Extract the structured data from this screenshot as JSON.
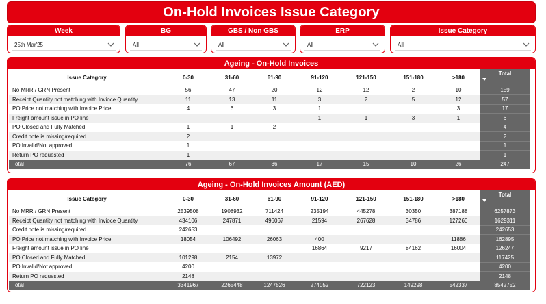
{
  "page_title": "On-Hold Invoices Issue Category",
  "filters": [
    {
      "label": "Week",
      "value": "25th Mar'25"
    },
    {
      "label": "BG",
      "value": "All"
    },
    {
      "label": "GBS / Non GBS",
      "value": "All"
    },
    {
      "label": "ERP",
      "value": "All"
    },
    {
      "label": "Issue Category",
      "value": "All"
    }
  ],
  "table1": {
    "title": "Ageing - On-Hold Invoices",
    "columns": [
      "Issue Category",
      "0-30",
      "31-60",
      "61-90",
      "91-120",
      "121-150",
      "151-180",
      ">180",
      "Total"
    ],
    "rows": [
      [
        "No MRR / GRN Present",
        "56",
        "47",
        "20",
        "12",
        "12",
        "2",
        "10",
        "159"
      ],
      [
        "Receipt Quantity not matching with Invioce Quantity",
        "11",
        "13",
        "11",
        "3",
        "2",
        "5",
        "12",
        "57"
      ],
      [
        "PO Price not matching with Invoice Price",
        "4",
        "6",
        "3",
        "1",
        "",
        "",
        "3",
        "17"
      ],
      [
        "Freight amount issue in PO line",
        "",
        "",
        "",
        "1",
        "1",
        "3",
        "1",
        "6"
      ],
      [
        "PO Closed and Fully Matched",
        "1",
        "1",
        "2",
        "",
        "",
        "",
        "",
        "4"
      ],
      [
        "Credit note is missing/required",
        "2",
        "",
        "",
        "",
        "",
        "",
        "",
        "2"
      ],
      [
        "PO Invalid/Not approved",
        "1",
        "",
        "",
        "",
        "",
        "",
        "",
        "1"
      ],
      [
        "Return PO requested",
        "1",
        "",
        "",
        "",
        "",
        "",
        "",
        "1"
      ]
    ],
    "total_row": [
      "Total",
      "76",
      "67",
      "36",
      "17",
      "15",
      "10",
      "26",
      "247"
    ]
  },
  "table2": {
    "title": "Ageing - On-Hold Invoices Amount (AED)",
    "columns": [
      "Issue Category",
      "0-30",
      "31-60",
      "61-90",
      "91-120",
      "121-150",
      "151-180",
      ">180",
      "Total"
    ],
    "rows": [
      [
        "No MRR / GRN Present",
        "2539508",
        "1908932",
        "711424",
        "235194",
        "445278",
        "30350",
        "387188",
        "6257873"
      ],
      [
        "Receipt Quantity not matching with Invioce Quantity",
        "434106",
        "247871",
        "496067",
        "21594",
        "267628",
        "34786",
        "127260",
        "1629311"
      ],
      [
        "Credit note is missing/required",
        "242653",
        "",
        "",
        "",
        "",
        "",
        "",
        "242653"
      ],
      [
        "PO Price not matching with Invoice Price",
        "18054",
        "106492",
        "26063",
        "400",
        "",
        "",
        "11886",
        "162895"
      ],
      [
        "Freight amount issue in PO line",
        "",
        "",
        "",
        "16864",
        "9217",
        "84162",
        "16004",
        "126247"
      ],
      [
        "PO Closed and Fully Matched",
        "101298",
        "2154",
        "13972",
        "",
        "",
        "",
        "",
        "117425"
      ],
      [
        "PO Invalid/Not approved",
        "4200",
        "",
        "",
        "",
        "",
        "",
        "",
        "4200"
      ],
      [
        "Return PO requested",
        "2148",
        "",
        "",
        "",
        "",
        "",
        "",
        "2148"
      ]
    ],
    "total_row": [
      "Total",
      "3341967",
      "2265448",
      "1247526",
      "274052",
      "722123",
      "149298",
      "542337",
      "8542752"
    ]
  },
  "colors": {
    "brand_red": "#e3000f",
    "total_gray": "#666666",
    "stripe": "#efefef"
  },
  "icons": {
    "dropdown": "chevron-down-icon",
    "sort": "sort-descending-icon"
  }
}
